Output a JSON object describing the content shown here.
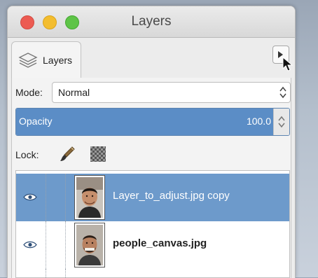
{
  "window": {
    "title": "Layers"
  },
  "tabs": [
    {
      "label": "Layers",
      "icon": "layers-stack-icon"
    }
  ],
  "mode": {
    "label": "Mode:",
    "value": "Normal"
  },
  "opacity": {
    "label": "Opacity",
    "value": "100.0",
    "fraction": 0.945
  },
  "lock": {
    "label": "Lock:",
    "icons": [
      "paintbrush-icon",
      "alpha-checkerboard-icon"
    ]
  },
  "layers": [
    {
      "name": "Layer_to_adjust.jpg copy",
      "selected": true,
      "visible": true
    },
    {
      "name": "people_canvas.jpg",
      "selected": false,
      "visible": true
    }
  ],
  "colors": {
    "selection": "#6d9acb",
    "opacity_fill": "#5b8dc6",
    "close": "#ec5b52",
    "minimize": "#f3bd2f",
    "maximize": "#5ec447"
  }
}
